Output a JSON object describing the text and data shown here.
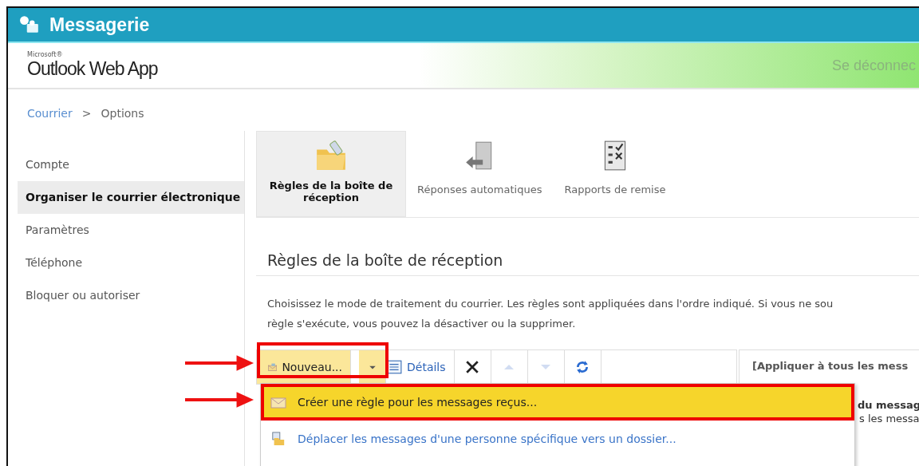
{
  "header": {
    "title": "Messagerie"
  },
  "brand": {
    "small": "Microsoft®",
    "name": "Outlook Web App",
    "signout": "Se déconnec"
  },
  "breadcrumb": [
    {
      "label": "Courrier",
      "kind": "link"
    },
    {
      "label": ">",
      "kind": "sep"
    },
    {
      "label": "Options",
      "kind": "current"
    }
  ],
  "sidebar": {
    "items": [
      {
        "label": "Compte",
        "selected": false
      },
      {
        "label": "Organiser le courrier électronique",
        "selected": true
      },
      {
        "label": "Paramètres",
        "selected": false
      },
      {
        "label": "Téléphone",
        "selected": false
      },
      {
        "label": "Bloquer ou autoriser",
        "selected": false
      }
    ]
  },
  "tabs": [
    {
      "label": "Règles de la boîte de réception",
      "kind": "folder",
      "selected": true
    },
    {
      "label": "Réponses automatiques",
      "kind": "door",
      "selected": false
    },
    {
      "label": "Rapports de remise",
      "kind": "checklist",
      "selected": false
    }
  ],
  "section": {
    "title": "Règles de la boîte de réception",
    "description": "Choisissez le mode de traitement du courrier. Les règles sont appliquées dans l'ordre indiqué. Si vous ne sou\nrègle s'exécute, vous pouvez la désactiver ou la supprimer."
  },
  "toolbar": [
    {
      "kind": "new",
      "label": "Nouveau..."
    },
    {
      "kind": "details",
      "label": "Détails"
    },
    {
      "kind": "delete",
      "disabled": false
    },
    {
      "kind": "up",
      "disabled": true
    },
    {
      "kind": "down",
      "disabled": true
    },
    {
      "kind": "refresh",
      "disabled": false
    }
  ],
  "details_panel": {
    "heading": "[Appliquer à tous les mess",
    "line_1": "du messag",
    "line_2": "s les messa"
  },
  "menu": {
    "items": [
      {
        "label": "Créer une règle pour les messages reçus...",
        "kind": "envelope",
        "selected": true
      },
      {
        "label": "Déplacer les messages d'une personne spécifique vers un dossier...",
        "kind": "move",
        "selected": false
      }
    ]
  }
}
